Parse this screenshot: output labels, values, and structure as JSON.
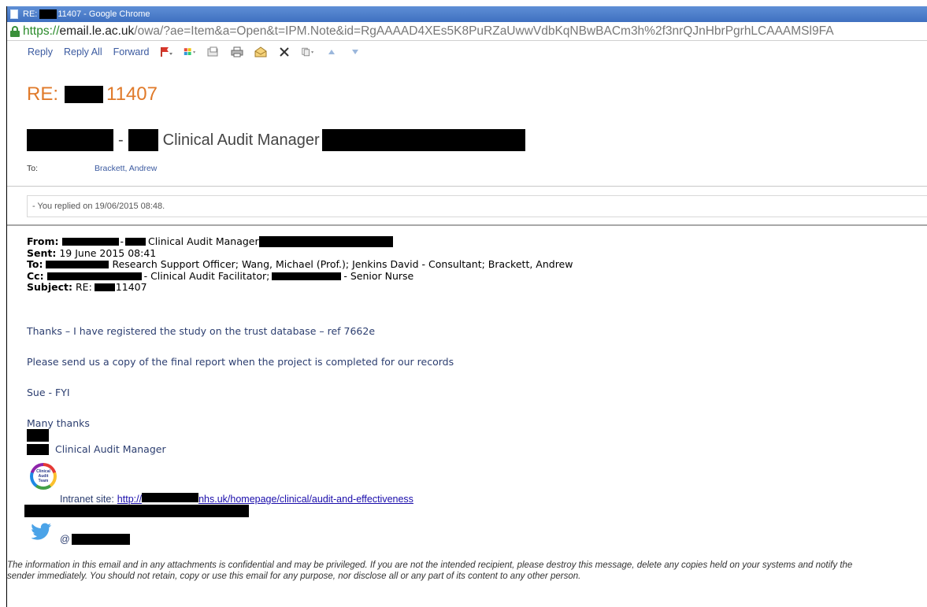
{
  "window": {
    "title_prefix": "RE:",
    "title_suffix": "11407 - Google Chrome"
  },
  "address_bar": {
    "scheme": "https://",
    "host": "email.le.ac.uk",
    "path": "/owa/?ae=Item&a=Open&t=IPM.Note&id=RgAAAAD4XEs5K8PuRZaUwwVdbKqNBwBACm3h%2f3nrQJnHbrPgrhLCAAAMSl9FA"
  },
  "toolbar": {
    "reply_label": "Reply",
    "reply_all_label": "Reply All",
    "forward_label": "Forward",
    "icons": [
      "flag-icon",
      "categories-icon",
      "move-icon",
      "print-icon",
      "mark-icon",
      "delete-icon",
      "copy-icon",
      "previous-icon",
      "next-icon"
    ]
  },
  "message": {
    "subject_prefix": "RE:",
    "subject_number": "11407",
    "sender_dash": "-",
    "sender_role": "Clinical Audit Manager",
    "to_label": "To:",
    "to_value": "Brackett, Andrew",
    "replied_notice": "- You replied on 19/06/2015 08:48."
  },
  "headers": {
    "from_label": "From:",
    "from_dash": "-",
    "from_role": "Clinical Audit Manager",
    "sent_label": "Sent:",
    "sent_value": "19 June 2015 08:41",
    "to_label": "To:",
    "to_value": "Research Support Officer; Wang, Michael (Prof.); Jenkins David - Consultant; Brackett, Andrew",
    "cc_label": "Cc:",
    "cc_value_1": "- Clinical Audit Facilitator;",
    "cc_value_2": "- Senior Nurse",
    "subject_label": "Subject:",
    "subject_prefix": "RE:",
    "subject_number": "11407"
  },
  "body": {
    "line1": "Thanks – I have registered the study on the trust database – ref 7662e",
    "line2": "Please send us a copy of the final report when the project is completed for our records",
    "line3": "Sue - FYI",
    "line4": "Many thanks"
  },
  "signature": {
    "title": "Clinical Audit Manager",
    "logo_text_1": "Clinical",
    "logo_text_2": "Audit",
    "logo_text_3": "Team",
    "intranet_label": "Intranet site:",
    "intranet_link_start": "http://",
    "intranet_link_end": "nhs.uk/homepage/clinical/audit-and-effectiveness",
    "twitter_at": "@"
  },
  "disclaimer": {
    "line1": "The information in this email and in any attachments is confidential and may be privileged.  If you are not the intended recipient, please destroy this message, delete any copies held on your systems and notify the",
    "line2": "sender immediately.  You should not retain, copy or use this email for any purpose, nor disclose all or any part of its content to any other person."
  },
  "colors": {
    "subject": "#e07a2a",
    "link": "#3b5aa0",
    "body_text": "#2c3e70",
    "titlebar": "#4f80cc"
  }
}
